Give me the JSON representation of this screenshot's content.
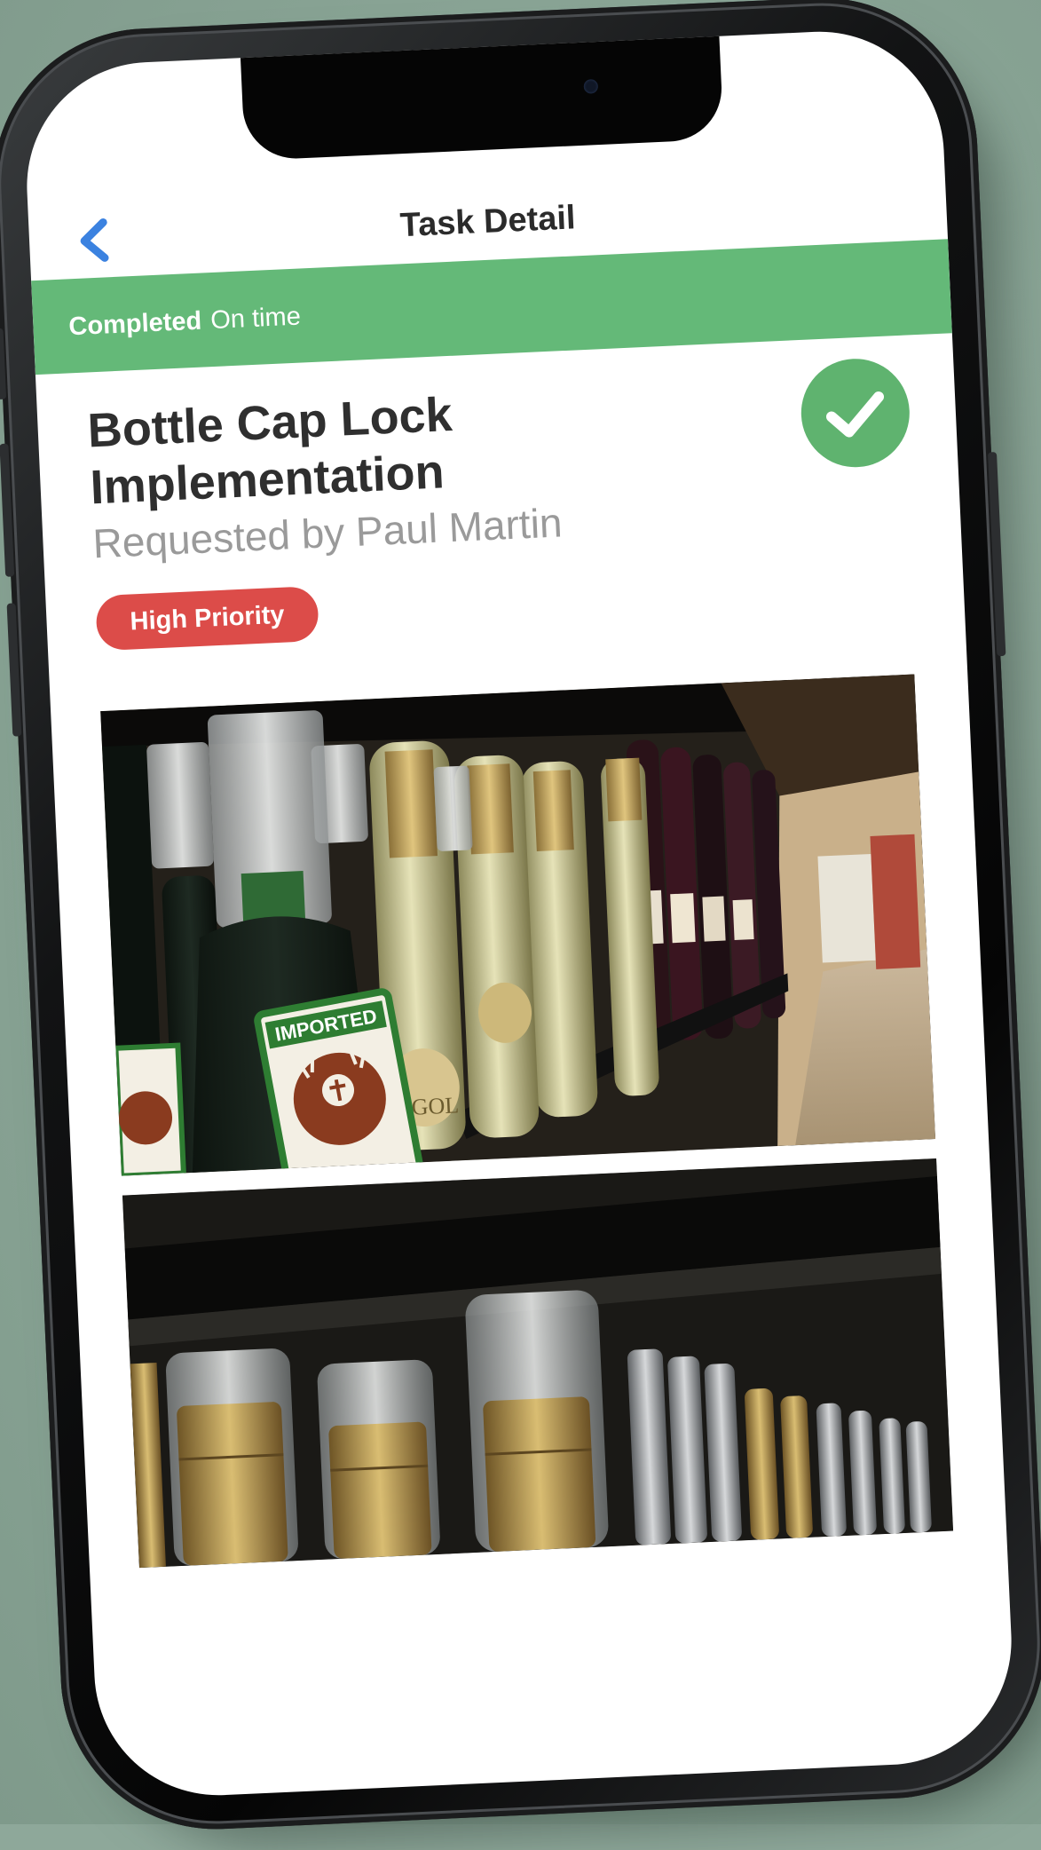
{
  "nav": {
    "title": "Task Detail"
  },
  "status": {
    "state": "Completed",
    "timeliness": "On time"
  },
  "task": {
    "title": "Bottle Cap Lock Implementation",
    "requested_by": "Requested by Paul Martin",
    "priority": "High Priority"
  },
  "labels": {
    "bottle_label_text": "IMPORTED"
  },
  "colors": {
    "status_green": "#64b978",
    "priority_red": "#dc4c49",
    "back_blue": "#3b82e0",
    "check_green": "#5fb36f"
  },
  "icons": {
    "back": "chevron-left-icon",
    "completed": "check-circle-icon"
  }
}
